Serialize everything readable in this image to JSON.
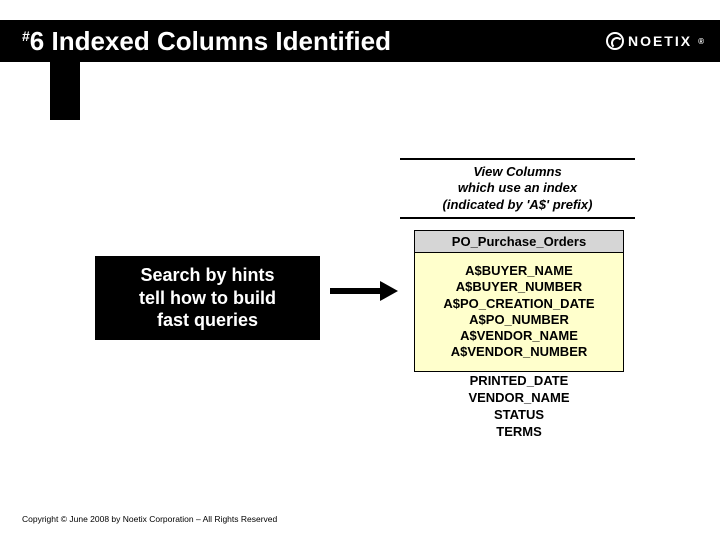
{
  "header": {
    "title_number_prefix": "#",
    "title_number": "6",
    "title_text": " Indexed Columns Identified",
    "logo_text": "NOETIX",
    "logo_reg": "®"
  },
  "caption": {
    "line1": "View Columns",
    "line2": "which use an index",
    "line3": "(indicated by 'A$' prefix)"
  },
  "table": {
    "name": "PO_Purchase_Orders",
    "indexed_columns": [
      "A$BUYER_NAME",
      "A$BUYER_NUMBER",
      "A$PO_CREATION_DATE",
      "A$PO_NUMBER",
      "A$VENDOR_NAME",
      "A$VENDOR_NUMBER"
    ],
    "plain_columns": [
      "PRINTED_DATE",
      "VENDOR_NAME",
      "STATUS",
      "TERMS"
    ]
  },
  "hint": {
    "line1": "Search by hints",
    "line2": "tell how to build",
    "line3": "fast queries"
  },
  "footer": "Copyright © June 2008 by Noetix Corporation – All Rights Reserved"
}
